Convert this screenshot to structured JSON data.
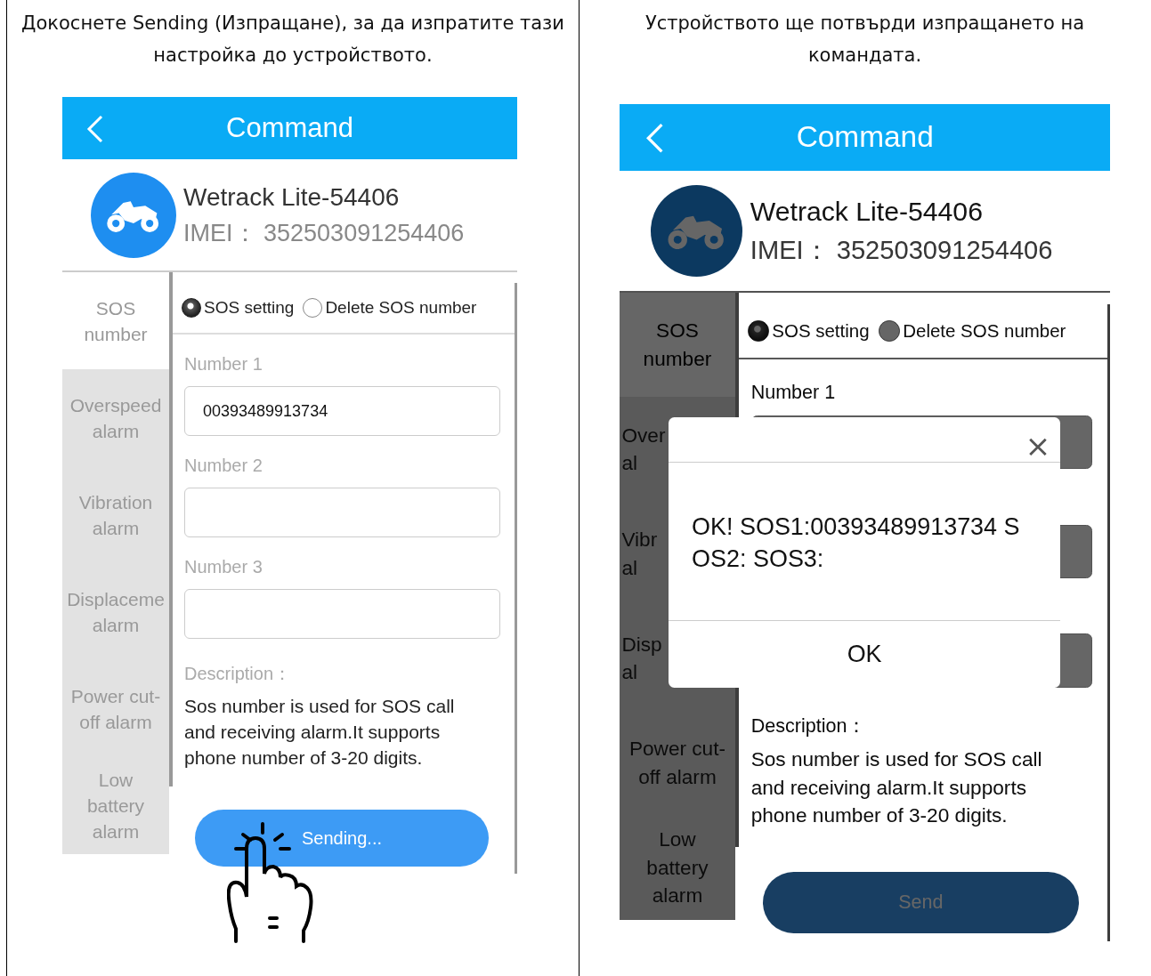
{
  "columns": [
    {
      "caption": "Докоснете Sending (Изпращане), за да изпратите тази настройка до устройството.",
      "phone": {
        "dimmed": false,
        "header": {
          "title": "Command"
        },
        "device": {
          "name": "Wetrack Lite-54406",
          "imei_label": "IMEI：",
          "imei": "352503091254406"
        },
        "sidebar": [
          {
            "lines": [
              "SOS",
              "number"
            ],
            "selected": true,
            "clipped": false
          },
          {
            "lines": [
              "Overspeed",
              "alarm"
            ],
            "selected": false,
            "clipped": false
          },
          {
            "lines": [
              "Vibration",
              "alarm"
            ],
            "selected": false,
            "clipped": false
          },
          {
            "lines": [
              "Displaceme",
              "alarm"
            ],
            "selected": false,
            "clipped": false
          },
          {
            "lines": [
              "Power cut-",
              "off alarm"
            ],
            "selected": false,
            "clipped": false
          },
          {
            "lines": [
              "Low",
              "battery",
              "alarm"
            ],
            "selected": false,
            "clipped": false
          }
        ],
        "radios": [
          {
            "label": "SOS setting",
            "selected": true
          },
          {
            "label": "Delete SOS number",
            "selected": false
          }
        ],
        "fields": [
          {
            "kind": "labeled",
            "label": "Number 1",
            "value": "00393489913734"
          },
          {
            "kind": "labeled",
            "label": "Number 2"
          },
          {
            "kind": "labeled",
            "label": "Number 3"
          }
        ],
        "description_label": "Description：",
        "description": "Sos number is used for SOS call and receiving alarm.It supports phone number of 3-20 digits.",
        "button": {
          "label": "Sending..."
        },
        "tap_hint": true
      }
    },
    {
      "caption": "Устройството ще потвърди изпращането на командата.",
      "phone": {
        "dimmed": true,
        "header": {
          "title": "Command"
        },
        "device": {
          "name": "Wetrack Lite-54406",
          "imei_label": "IMEI：",
          "imei": "352503091254406"
        },
        "sidebar": [
          {
            "lines": [
              "SOS",
              "number"
            ],
            "selected": true,
            "clipped": false
          },
          {
            "lines": [
              "Over",
              "al"
            ],
            "selected": false,
            "clipped": true
          },
          {
            "lines": [
              "Vibr",
              "al"
            ],
            "selected": false,
            "clipped": true
          },
          {
            "lines": [
              "Disp",
              "al"
            ],
            "selected": false,
            "clipped": true
          },
          {
            "lines": [
              "Power cut-",
              "off alarm"
            ],
            "selected": false,
            "clipped": false
          },
          {
            "lines": [
              "Low",
              "battery",
              "alarm"
            ],
            "selected": false,
            "clipped": false
          }
        ],
        "radios": [
          {
            "label": "SOS setting",
            "selected": true
          },
          {
            "label": "Delete SOS number",
            "selected": false
          }
        ],
        "fields": [
          {
            "kind": "labeled",
            "label": "Number 1"
          },
          {
            "kind": "unlabeled"
          },
          {
            "kind": "unlabeled"
          }
        ],
        "description_label": "Description：",
        "description": "Sos number is used for SOS call and receiving alarm.It supports phone number of 3-20 digits.",
        "button": {
          "label": "Send"
        },
        "tap_hint": false,
        "dialog": {
          "close": "×",
          "message_lines": [
            "OK! SOS1:00393489913734 S",
            "OS2: SOS3:"
          ],
          "ok": "OK"
        }
      }
    }
  ]
}
